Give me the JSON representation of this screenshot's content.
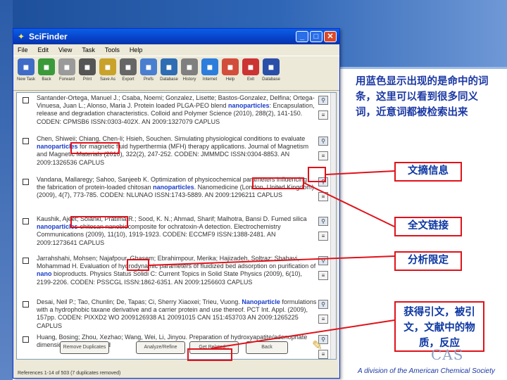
{
  "app": {
    "title": "SciFinder"
  },
  "menu": [
    "File",
    "Edit",
    "View",
    "Task",
    "Tools",
    "Help"
  ],
  "toolbar": [
    {
      "label": "New Task",
      "icon": "new-task-icon",
      "color": "#3e6cc7"
    },
    {
      "label": "Back",
      "icon": "back-icon",
      "color": "#3a9a3a"
    },
    {
      "label": "Forward",
      "icon": "forward-icon",
      "color": "#9a9a9a"
    },
    {
      "label": "Print",
      "icon": "print-icon",
      "color": "#555555"
    },
    {
      "label": "Save As",
      "icon": "save-as-icon",
      "color": "#c9a22b"
    },
    {
      "label": "Export",
      "icon": "export-icon",
      "color": "#666666"
    },
    {
      "label": "Prefs",
      "icon": "prefs-icon",
      "color": "#4a7fd0"
    },
    {
      "label": "Database",
      "icon": "database-icon",
      "color": "#2e6cb3"
    },
    {
      "label": "History",
      "icon": "history-icon",
      "color": "#7f7f7f"
    },
    {
      "label": "Internet",
      "icon": "internet-icon",
      "color": "#2d7ddc"
    },
    {
      "label": "Help",
      "icon": "help-icon",
      "color": "#d24d3c"
    },
    {
      "label": "Exit",
      "icon": "exit-icon",
      "color": "#cc3333"
    },
    {
      "label": "Database",
      "icon": "database-stack-icon",
      "color": "#2a4fa8"
    }
  ],
  "records": [
    {
      "text_pre": "Santander-Ortega, Manuel J.; Csaba, Noemi; Gonzalez, Lisette; Bastos-Gonzalez, Delfina; Ortega-Vinuesa, Juan L.; Alonso, Maria J. Protein loaded PLGA-PEO blend ",
      "hl": "nanoparticles",
      "text_post": ": Encapsulation, release and degradation characteristics. Colloid and Polymer Science (2010), 288(2), 141-150. CODEN: CPMSB6 ISSN:0303-402X. AN 2009:1327079 CAPLUS"
    },
    {
      "text_pre": "Chen, Shiweii; Chiang, Chen-li; Hsieh, Souchen. Simulating physiological conditions to evaluate ",
      "hl": "nanoparticles",
      "text_post": " for magnetic fluid hyperthermia (MFH) therapy applications. Journal of Magnetism and Magnetic Materials (2010), 322(2), 247-252. CODEN: JMMMDC ISSN:0304-8853. AN 2009:1326536 CAPLUS"
    },
    {
      "text_pre": "Vandana, Mallaregy; Sahoo, Sanjeeb K. Optimization of physicochemical parameters influencing the fabrication of protein-loaded chitosan ",
      "hl": "nanoparticles",
      "text_post": ". Nanomedicine (London, United Kingdom) (2009), 4(7), 773-785. CODEN: NLUNAO ISSN:1743-5889. AN 2009:1296211 CAPLUS"
    },
    {
      "text_pre": "Kaushik, Ajeet; Solanki, Pratima R.; Sood, K. N.; Ahmad, Sharif; Malhotra, Bansi D. Fumed silica ",
      "hl": "nanoparticles",
      "text_post": "-chitosan nanobiocomposite for ochratoxin-A detection. Electrochemistry Communications (2009), 11(10), 1919-1923. CODEN: ECCMF9 ISSN:1388-2481. AN 2009:1273641 CAPLUS"
    },
    {
      "text_pre": "Jarrahshahi, Mohsen; Najafpour, Ghasem; Ebrahimpour, Merika; Hajizadeh, Soltraz; Shahavi, Mohammad H. Evaluation of hydrodynamic parameters of fluidized bed adsorption on purification of ",
      "hl": "nano",
      "text_post": " bioproducts. Physics Status Solidi C: Current Topics in Solid State Physics (2009), 6(10), 2199-2206. CODEN: PSSCGL ISSN:1862-6351. AN 2009:1256603 CAPLUS"
    },
    {
      "text_pre": "Desai, Neil P.; Tao, Chunlin; De, Tapas; Ci, Sherry Xiaoxei; Trieu, Vuong. ",
      "hl": "Nanoparticle",
      "text_post": " formulations with a hydrophobic taxane derivative and a carrier protein and use thereof. PCT Int. Appl. (2009), 157pp. CODEN: PIXXD2 WO 2009126938 A1 20091015 CAN 151:453703 AN 2009:1265225 CAPLUS"
    },
    {
      "text_pre": "Huang, Bosing; Zhou, Xezhao; Wang, Wei, Li, Jinyou. Preparation of hydroxyapatite/adenophate dimensional liver specified ",
      "hl": "",
      "text_post": ""
    }
  ],
  "bottom_buttons": [
    "Remove Duplicates",
    "Analyze/Refine",
    "Get Related...",
    "Back"
  ],
  "status": "References 1-14 of 503 (7 duplicates removed)",
  "annotations": {
    "intro": "用蓝色显示出现的是命中的词条，这里可以看到很多同义词，近意词都被检索出来",
    "abstract": "文摘信息",
    "fulltext": "全文链接",
    "analyze": "分析限定",
    "related": "获得引文，被引文，文献中的物质，反应"
  },
  "footer": {
    "division": "A division of the American Chemical Society",
    "logo": "CAS"
  },
  "colors": {
    "highlight": "#1a3cc8",
    "callout_border": "#e0121a",
    "callout_text": "#0c37a3"
  }
}
